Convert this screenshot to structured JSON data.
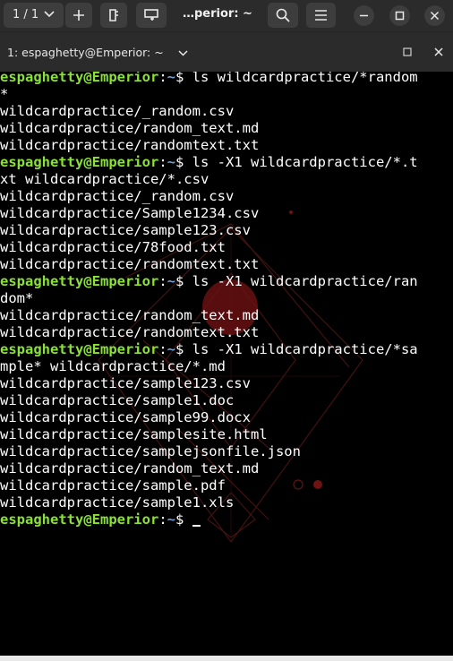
{
  "header": {
    "tab_counter": "1 / 1",
    "title": "…perior: ~"
  },
  "tab": {
    "title": "1: espaghetty@Emperior: ~"
  },
  "icons": {
    "chevron": "chevron-down-icon",
    "new_tab": "plus-icon",
    "split": "split-terminal-icon",
    "search": "search-icon",
    "menu": "hamburger-menu-icon",
    "minimize": "minimize-icon",
    "maximize": "maximize-icon",
    "close": "close-icon"
  },
  "colors": {
    "prompt_user": "#8ae234",
    "prompt_path": "#729fcf",
    "text": "#ffffff",
    "background": "#000000",
    "chrome": "#2b2b2b"
  },
  "terminal": {
    "lines": [
      {
        "type": "prompt",
        "user": "espaghetty@Emperior",
        "sep": ":",
        "path": "~",
        "cmd": "$ ls wildcardpractice/*random"
      },
      {
        "type": "out",
        "text": "*"
      },
      {
        "type": "out",
        "text": "wildcardpractice/_random.csv"
      },
      {
        "type": "out",
        "text": "wildcardpractice/random_text.md"
      },
      {
        "type": "out",
        "text": "wildcardpractice/randomtext.txt"
      },
      {
        "type": "prompt",
        "user": "espaghetty@Emperior",
        "sep": ":",
        "path": "~",
        "cmd": "$ ls -X1 wildcardpractice/*.t"
      },
      {
        "type": "out",
        "text": "xt wildcardpractice/*.csv"
      },
      {
        "type": "out",
        "text": "wildcardpractice/_random.csv"
      },
      {
        "type": "out",
        "text": "wildcardpractice/Sample1234.csv"
      },
      {
        "type": "out",
        "text": "wildcardpractice/sample123.csv"
      },
      {
        "type": "out",
        "text": "wildcardpractice/78food.txt"
      },
      {
        "type": "out",
        "text": "wildcardpractice/randomtext.txt"
      },
      {
        "type": "prompt",
        "user": "espaghetty@Emperior",
        "sep": ":",
        "path": "~",
        "cmd": "$ ls -X1 wildcardpractice/ran"
      },
      {
        "type": "out",
        "text": "dom*"
      },
      {
        "type": "out",
        "text": "wildcardpractice/random_text.md"
      },
      {
        "type": "out",
        "text": "wildcardpractice/randomtext.txt"
      },
      {
        "type": "prompt",
        "user": "espaghetty@Emperior",
        "sep": ":",
        "path": "~",
        "cmd": "$ ls -X1 wildcardpractice/*sa"
      },
      {
        "type": "out",
        "text": "mple* wildcardpractice/*.md"
      },
      {
        "type": "out",
        "text": "wildcardpractice/sample123.csv"
      },
      {
        "type": "out",
        "text": "wildcardpractice/sample1.doc"
      },
      {
        "type": "out",
        "text": "wildcardpractice/sample99.docx"
      },
      {
        "type": "out",
        "text": "wildcardpractice/samplesite.html"
      },
      {
        "type": "out",
        "text": "wildcardpractice/samplejsonfile.json"
      },
      {
        "type": "out",
        "text": "wildcardpractice/random_text.md"
      },
      {
        "type": "out",
        "text": "wildcardpractice/sample.pdf"
      },
      {
        "type": "out",
        "text": "wildcardpractice/sample1.xls"
      },
      {
        "type": "prompt",
        "user": "espaghetty@Emperior",
        "sep": ":",
        "path": "~",
        "cmd": "$ ",
        "cursor": true
      }
    ]
  }
}
